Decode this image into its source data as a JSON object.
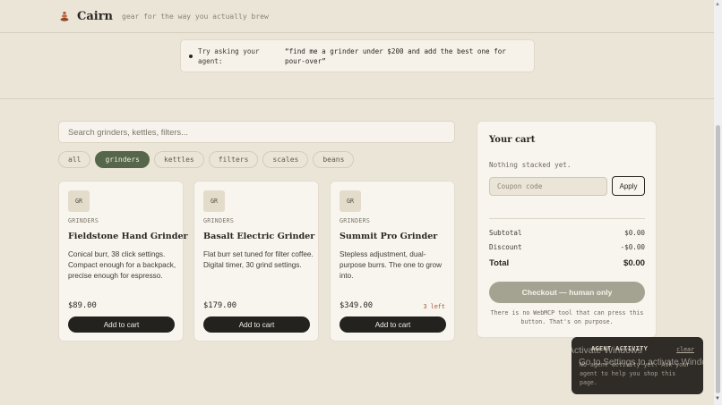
{
  "header": {
    "brand": "Cairn",
    "tagline": "gear for the way you actually brew",
    "logo_icon": "cairn-stones-icon"
  },
  "hint": {
    "label": "Try asking your agent:",
    "quote": "“find me a grinder under $200 and add the best one for pour-over”"
  },
  "search": {
    "placeholder": "Search grinders, kettles, filters..."
  },
  "filters": [
    {
      "label": "all",
      "active": false
    },
    {
      "label": "grinders",
      "active": true
    },
    {
      "label": "kettles",
      "active": false
    },
    {
      "label": "filters",
      "active": false
    },
    {
      "label": "scales",
      "active": false
    },
    {
      "label": "beans",
      "active": false
    }
  ],
  "products": [
    {
      "badge": "GR",
      "category": "GRINDERS",
      "name": "Fieldstone Hand Grinder",
      "description": "Conical burr, 38 click settings. Compact enough for a backpack, precise enough for espresso.",
      "price": "$89.00",
      "stock": "",
      "button": "Add to cart"
    },
    {
      "badge": "GR",
      "category": "GRINDERS",
      "name": "Basalt Electric Grinder",
      "description": "Flat burr set tuned for filter coffee. Digital timer, 30 grind settings.",
      "price": "$179.00",
      "stock": "",
      "button": "Add to cart"
    },
    {
      "badge": "GR",
      "category": "GRINDERS",
      "name": "Summit Pro Grinder",
      "description": "Stepless adjustment, dual-purpose burrs. The one to grow into.",
      "price": "$349.00",
      "stock": "3 left",
      "button": "Add to cart"
    }
  ],
  "cart": {
    "title": "Your cart",
    "empty_text": "Nothing stacked yet.",
    "coupon_placeholder": "Coupon code",
    "apply_label": "Apply",
    "subtotal_label": "Subtotal",
    "subtotal_value": "$0.00",
    "discount_label": "Discount",
    "discount_value": "-$0.00",
    "total_label": "Total",
    "total_value": "$0.00",
    "checkout_label": "Checkout — human only",
    "note": "There is no WebMCP tool that can press this button. That's on purpose."
  },
  "agent": {
    "title": "AGENT ACTIVITY",
    "clear_label": "clear",
    "body": "No agent activity yet. Ask your agent to help you shop this page."
  },
  "watermark": {
    "line1": "Activate Windows",
    "line2": "Go to Settings to activate Windows."
  },
  "colors": {
    "background": "#ebe5d8",
    "accent_green": "#55664b",
    "button_dark": "#24221e",
    "checkout_disabled": "#a4a392",
    "stock_warning": "#a05b35"
  }
}
